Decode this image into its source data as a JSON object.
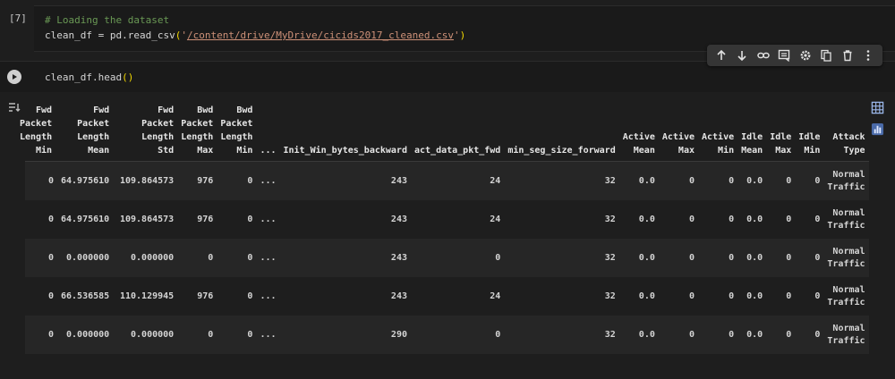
{
  "cell1": {
    "exec_count": "[7]",
    "comment": "# Loading the dataset",
    "code_prefix": "clean_df = pd.read_csv",
    "open_paren": "(",
    "quote_open": "'",
    "path": "/content/drive/MyDrive/cicids2017_cleaned.csv",
    "quote_close": "'",
    "close_paren": ")"
  },
  "toolbar": {
    "icons": [
      "arrow-up-icon",
      "arrow-down-icon",
      "link-icon",
      "comment-icon",
      "gear-icon",
      "mirror-cell-icon",
      "trash-icon",
      "more-icon"
    ]
  },
  "cell2": {
    "code_prefix": "clean_df.head",
    "open_paren": "(",
    "close_paren": ")"
  },
  "table": {
    "columns": [
      [
        "Fwd",
        "Packet",
        "Length",
        "Min"
      ],
      [
        "Fwd",
        "Packet",
        "Length",
        "Mean"
      ],
      [
        "Fwd",
        "Packet",
        "Length",
        "Std"
      ],
      [
        "Bwd",
        "Packet",
        "Length",
        "Max"
      ],
      [
        "Bwd",
        "Packet",
        "Length",
        "Min"
      ],
      [
        "..."
      ],
      [
        "Init_Win_bytes_backward"
      ],
      [
        "act_data_pkt_fwd"
      ],
      [
        "min_seg_size_forward"
      ],
      [
        "Active",
        "Mean"
      ],
      [
        "Active",
        "Max"
      ],
      [
        "Active",
        "Min"
      ],
      [
        "Idle",
        "Mean"
      ],
      [
        "Idle",
        "Max"
      ],
      [
        "Idle",
        "Min"
      ],
      [
        "Attack",
        "Type"
      ]
    ],
    "rows": [
      [
        "0",
        "64.975610",
        "109.864573",
        "976",
        "0",
        "...",
        "243",
        "24",
        "32",
        "0.0",
        "0",
        "0",
        "0.0",
        "0",
        "0",
        "Normal Traffic"
      ],
      [
        "0",
        "64.975610",
        "109.864573",
        "976",
        "0",
        "...",
        "243",
        "24",
        "32",
        "0.0",
        "0",
        "0",
        "0.0",
        "0",
        "0",
        "Normal Traffic"
      ],
      [
        "0",
        "0.000000",
        "0.000000",
        "0",
        "0",
        "...",
        "243",
        "0",
        "32",
        "0.0",
        "0",
        "0",
        "0.0",
        "0",
        "0",
        "Normal Traffic"
      ],
      [
        "0",
        "66.536585",
        "110.129945",
        "976",
        "0",
        "...",
        "243",
        "24",
        "32",
        "0.0",
        "0",
        "0",
        "0.0",
        "0",
        "0",
        "Normal Traffic"
      ],
      [
        "0",
        "0.000000",
        "0.000000",
        "0",
        "0",
        "...",
        "290",
        "0",
        "32",
        "0.0",
        "0",
        "0",
        "0.0",
        "0",
        "0",
        "Normal Traffic"
      ]
    ]
  },
  "colors": {
    "background": "#1e1e1e",
    "comment": "#6a9955",
    "string": "#ce9178",
    "bracket": "#f1d700",
    "text": "#d4d4d4"
  }
}
